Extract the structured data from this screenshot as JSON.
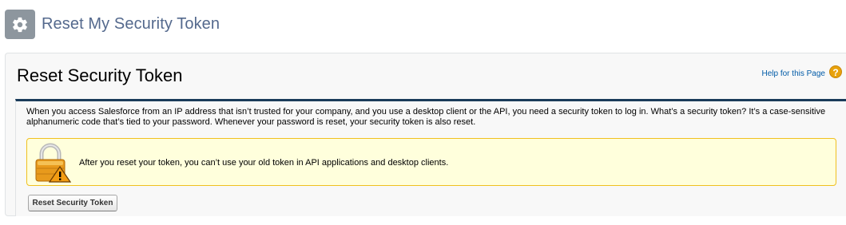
{
  "header": {
    "title": "Reset My Security Token",
    "icon": "gear-icon"
  },
  "section": {
    "title": "Reset Security Token",
    "help_link": "Help for this Page",
    "help_icon": "?"
  },
  "content": {
    "intro": "When you access Salesforce from an IP address that isn’t trusted for your company, and you use a desktop client or the API, you need a security token to log in. What’s a security token? It’s a case-sensitive alphanumeric code that’s tied to your password. Whenever your password is reset, your security token is also reset.",
    "warning": "After you reset your token, you can’t use your old token in API applications and desktop clients.",
    "warning_icon": "lock-warning-icon",
    "button_label": "Reset Security Token"
  },
  "colors": {
    "accent_bar": "#1a3b5a",
    "warning_bg": "#ffffdc",
    "warning_border": "#f0c020",
    "help_icon": "#e8a20c"
  }
}
